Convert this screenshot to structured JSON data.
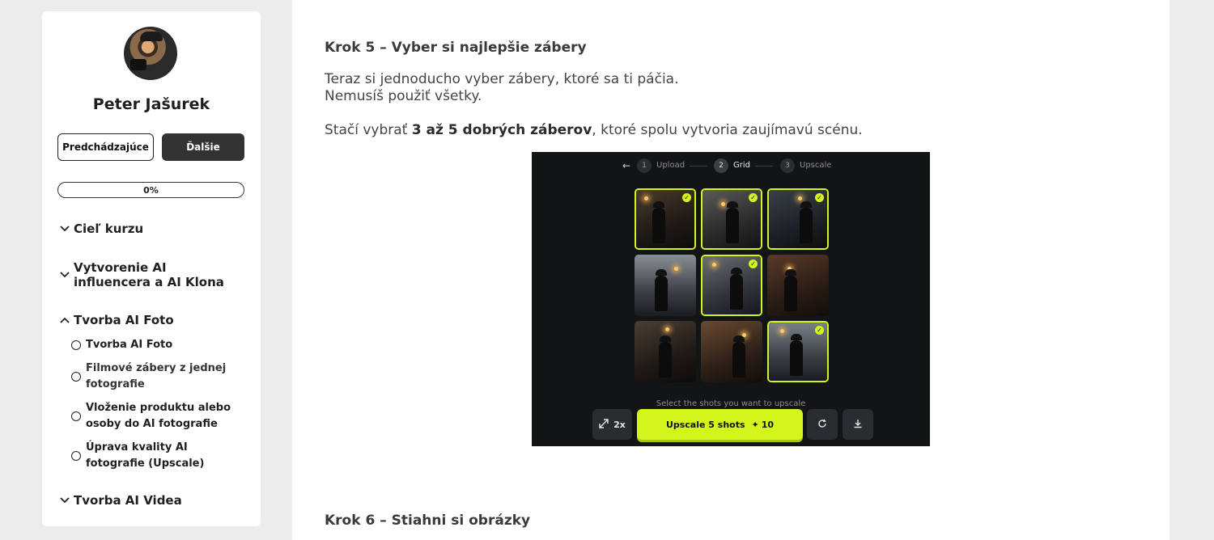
{
  "sidebar": {
    "author_name": "Peter Jašurek",
    "prev_label": "Predchádzajúce",
    "next_label": "Ďalšie",
    "progress_text": "0%",
    "progress_value": 0,
    "sections": [
      {
        "title": "Cieľ kurzu",
        "expanded": false
      },
      {
        "title": "Vytvorenie AI influencera a AI Klona",
        "expanded": false
      },
      {
        "title": "Tvorba AI Foto",
        "expanded": true,
        "lessons": [
          "Tvorba AI Foto",
          "Filmové zábery z jednej fotografie",
          "Vloženie produktu alebo osoby do AI fotografie",
          "Úprava kvality AI fotografie (Upscale)"
        ]
      },
      {
        "title": "Tvorba AI Videa",
        "expanded": false
      }
    ]
  },
  "content": {
    "step5_heading": "Krok 5 – Vyber si najlepšie zábery",
    "line1": "Teraz si jednoducho vyber zábery, ktoré sa ti páčia.",
    "line2": "Nemusíš použiť všetky.",
    "line3_pre": "Stačí vybrať ",
    "line3_bold": "3 až 5 dobrých záberov",
    "line3_post": ", ktoré spolu vytvoria zaujímavú scénu.",
    "step6_heading": "Krok 6 – Stiahni si obrázky"
  },
  "app": {
    "steps": [
      {
        "num": "1",
        "label": "Upload",
        "active": false
      },
      {
        "num": "2",
        "label": "Grid",
        "active": true
      },
      {
        "num": "3",
        "label": "Upscale",
        "active": false
      }
    ],
    "grid_selected": [
      true,
      true,
      true,
      false,
      true,
      false,
      false,
      false,
      true
    ],
    "caption": "Select the shots you want to upscale",
    "zoom_label": "2x",
    "upscale_label": "Upscale 5 shots",
    "credits": "10",
    "accent": "#d4f51c"
  }
}
